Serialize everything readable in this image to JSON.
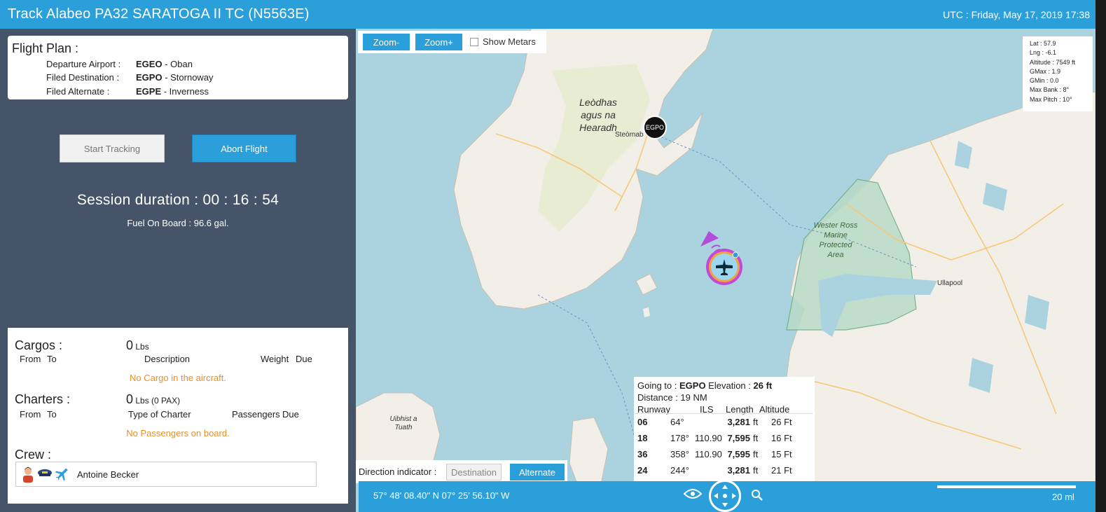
{
  "window": {
    "title": "Track Alabeo PA32 SARATOGA II TC (N5563E)",
    "utc": "UTC : Friday, May 17, 2019 17:38"
  },
  "flight_plan": {
    "title": "Flight Plan :",
    "rows": [
      {
        "label": "Departure Airport :",
        "code": "EGEO",
        "name": " - Oban"
      },
      {
        "label": "Filed Destination :",
        "code": "EGPO",
        "name": " - Stornoway"
      },
      {
        "label": "Filed Alternate :",
        "code": "EGPE",
        "name": " - Inverness"
      }
    ]
  },
  "buttons": {
    "start_tracking": "Start Tracking",
    "abort_flight": "Abort Flight"
  },
  "session": {
    "duration": "Session duration : 00 : 16 : 54",
    "fuel": "Fuel On Board : 96.6 gal."
  },
  "cargos": {
    "title": "Cargos :",
    "value": "0",
    "unit": " Lbs",
    "columns": [
      "From",
      "To",
      "Description",
      "Weight",
      "Due"
    ],
    "empty": "No Cargo in the aircraft."
  },
  "charters": {
    "title": "Charters :",
    "value": "0",
    "unit": " Lbs (0 PAX)",
    "columns": [
      "From",
      "To",
      "Type of Charter",
      "Passengers",
      "Due"
    ],
    "empty": "No Passengers on board."
  },
  "crew": {
    "title": "Crew :",
    "member": "Antoine Becker",
    "icons": [
      "person-avatar-icon",
      "pilot-cap-icon",
      "airplane-icon"
    ]
  },
  "map": {
    "zoom_minus": "Zoom-",
    "zoom_plus": "Zoom+",
    "show_metars": "Show Metars",
    "stats": {
      "lat": "Lat : 57.9",
      "lng": "Lng : -6.1",
      "altitude": "Altitude : 7549 ft",
      "gmax": "GMax : 1.9",
      "gmin": "GMin : 0.0",
      "max_bank": "Max Bank : 8°",
      "max_pitch": "Max Pitch : 10°"
    },
    "labels": {
      "lewis": "Leòdhas agus na Hearadh",
      "stornoway": "Steòrnab",
      "egpo_marker": "EGPO",
      "wester_ross": "Wester Ross Marine Protected Area",
      "ullapool": "Ullapool",
      "uibhist": "Uibhist a Tuath"
    },
    "info": {
      "going_to_label": "Going to : ",
      "going_to_code": "EGPO",
      "elevation_label": " Elevation : ",
      "elevation_value": "26 ft",
      "distance": "Distance : 19 NM",
      "headers": [
        "Runway",
        "ILS",
        "Length",
        "Altitude"
      ],
      "runways": [
        {
          "rwy": "06",
          "hdg": "64°",
          "ils": "",
          "len": "3,281",
          "unit": "ft",
          "alt": "26 Ft"
        },
        {
          "rwy": "18",
          "hdg": "178°",
          "ils": "110.90",
          "len": "7,595",
          "unit": "ft",
          "alt": "16 Ft"
        },
        {
          "rwy": "36",
          "hdg": "358°",
          "ils": "110.90",
          "len": "7,595",
          "unit": "ft",
          "alt": "15 Ft"
        },
        {
          "rwy": "24",
          "hdg": "244°",
          "ils": "",
          "len": "3,281",
          "unit": "ft",
          "alt": "21 Ft"
        }
      ]
    },
    "direction": {
      "label": "Direction indicator :",
      "destination": "Destination",
      "alternate": "Alternate"
    },
    "bottom": {
      "coords": "57° 48' 08.40\" N 07° 25' 56.10\" W",
      "scale": "20 ml"
    }
  },
  "colors": {
    "accent": "#2b9fd9",
    "panel": "#46546a",
    "sea": "#aad3df",
    "land": "#f2efe9",
    "warning_text": "#e8902a",
    "plane_ring": "#c24ad6"
  }
}
